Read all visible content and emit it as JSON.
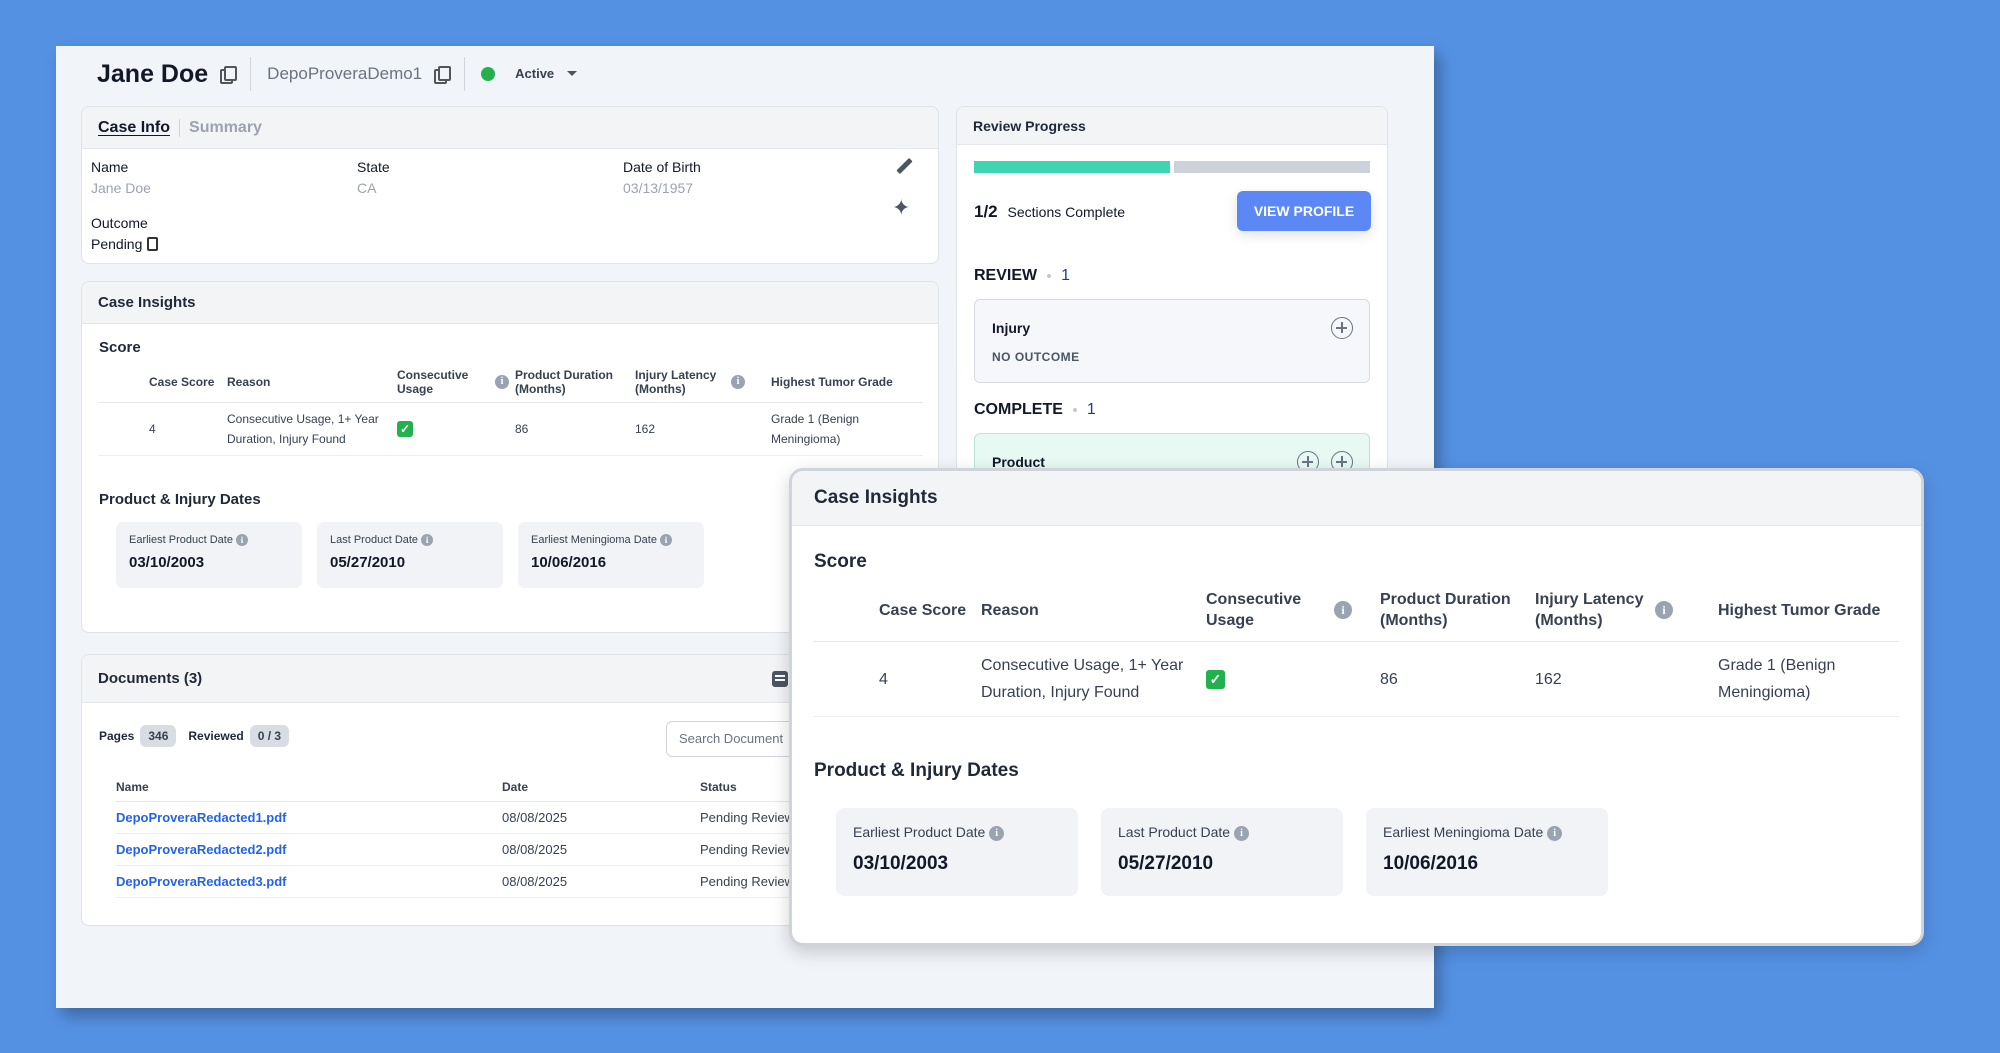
{
  "header": {
    "name": "Jane Doe",
    "project": "DepoProveraDemo1",
    "status": "Active",
    "status_color": "#22b14c"
  },
  "case_info": {
    "tab_active": "Case Info",
    "tab_other": "Summary",
    "fields": {
      "name_label": "Name",
      "name_value": "Jane Doe",
      "state_label": "State",
      "state_value": "CA",
      "dob_label": "Date of Birth",
      "dob_value": "03/13/1957",
      "outcome_label": "Outcome",
      "outcome_value": "Pending"
    }
  },
  "insights": {
    "title": "Case Insights",
    "score_title": "Score",
    "columns": [
      "Case Score",
      "Reason",
      "Consecutive Usage",
      "Product Duration (Months)",
      "Injury Latency (Months)",
      "Highest Tumor Grade"
    ],
    "row": {
      "case_score": "4",
      "reason": "Consecutive Usage, 1+ Year Duration, Injury Found",
      "product_duration": "86",
      "injury_latency": "162",
      "tumor_grade": "Grade 1 (Benign Meningioma)"
    },
    "dates_title": "Product & Injury Dates",
    "dates": [
      {
        "label": "Earliest Product Date",
        "value": "03/10/2003"
      },
      {
        "label": "Last Product Date",
        "value": "05/27/2010"
      },
      {
        "label": "Earliest Meningioma Date",
        "value": "10/06/2016"
      }
    ]
  },
  "documents": {
    "title": "Documents (3)",
    "pages_label": "Pages",
    "pages_value": "346",
    "reviewed_label": "Reviewed",
    "reviewed_value": "0 / 3",
    "search_placeholder": "Search Document",
    "columns": [
      "Name",
      "Date",
      "Status"
    ],
    "rows": [
      {
        "name": "DepoProveraRedacted1.pdf",
        "date": "08/08/2025",
        "status": "Pending Review"
      },
      {
        "name": "DepoProveraRedacted2.pdf",
        "date": "08/08/2025",
        "status": "Pending Review"
      },
      {
        "name": "DepoProveraRedacted3.pdf",
        "date": "08/08/2025",
        "status": "Pending Review"
      }
    ]
  },
  "review_progress": {
    "title": "Review Progress",
    "progress_fraction": 0.5,
    "progress_color": "#3dd6b0",
    "sections_count": "1/2",
    "sections_label": "Sections Complete",
    "view_profile": "VIEW PROFILE",
    "review_heading": "REVIEW",
    "review_count": "1",
    "review_item_title": "Injury",
    "review_item_sub": "NO OUTCOME",
    "complete_heading": "COMPLETE",
    "complete_count": "1",
    "complete_item_title": "Product"
  },
  "icons": [
    "copy-icon",
    "pencil-icon",
    "sparkle-icon",
    "clipboard-icon",
    "info-icon",
    "checkmark-icon",
    "list-icon",
    "plus-circle-icon",
    "chevron-down-icon"
  ]
}
